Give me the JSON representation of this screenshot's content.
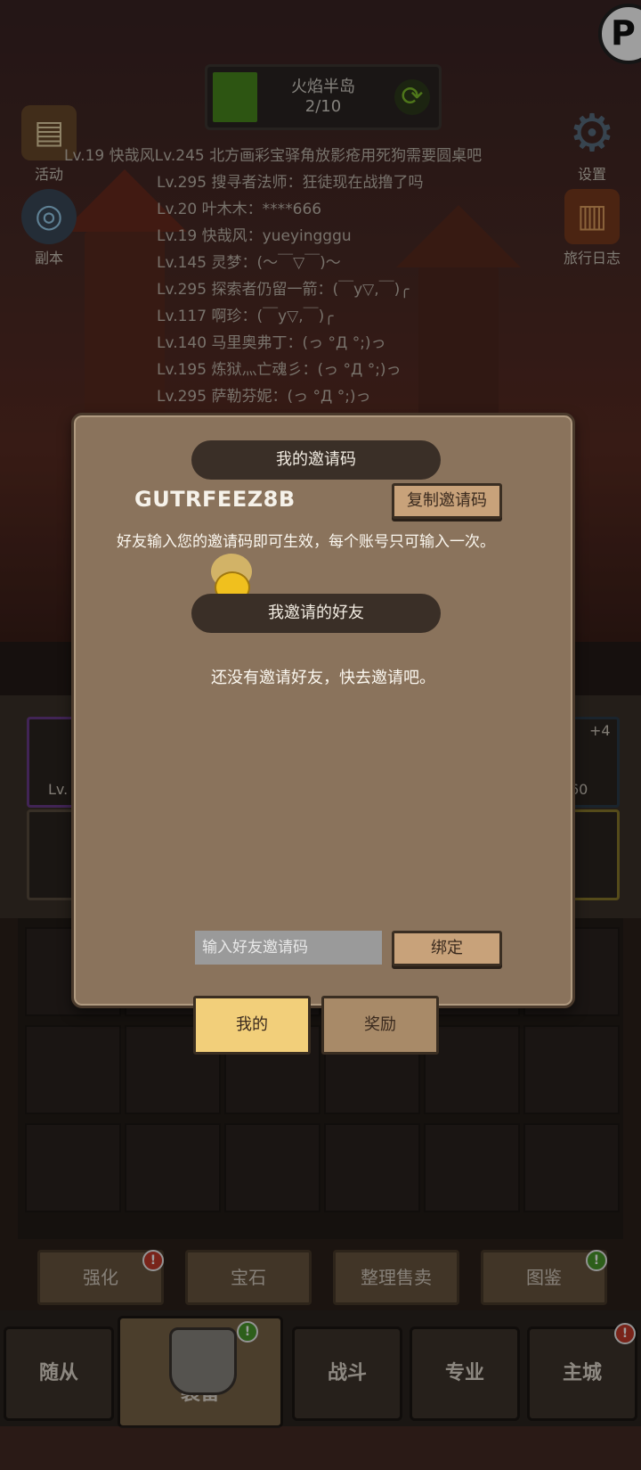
{
  "header": {
    "map_name": "火焰半岛",
    "map_progress": "2/10",
    "left_buttons": [
      "活动",
      "副本"
    ],
    "right_buttons": [
      "设置",
      "旅行日志"
    ]
  },
  "chat": [
    "Lv.19 快哉风Lv.245 北方画彩宝驿角放影疮用死狗需要圆桌吧",
    "Lv.295 搜寻者法师：狂徒现在战撸了吗",
    "Lv.20 叶木木：****666",
    "Lv.19 快哉风：yueyingggu",
    "Lv.145 灵梦：(～￣▽￣)～",
    "Lv.295 探索者仍留一箭：(￣y▽,￣)╭",
    "Lv.117 啊珍：(￣y▽,￣)╭",
    "Lv.140 马里奥弗丁：(っ °Д °;)っ",
    "Lv.195 炼狱灬亡魂彡：(っ °Д °;)っ",
    "Lv.295 萨勒芬妮：(っ °Д °;)っ"
  ],
  "equipment": {
    "slot_left_label": "Lv.",
    "slot_right_plus": "+4",
    "slot_right_value": "60"
  },
  "actions": [
    {
      "label": "强化",
      "badge": "!"
    },
    {
      "label": "宝石",
      "badge": ""
    },
    {
      "label": "整理售卖",
      "badge": ""
    },
    {
      "label": "图鉴",
      "badge": "!"
    }
  ],
  "nav": [
    "随从",
    "装备",
    "战斗",
    "专业",
    "主城"
  ],
  "modal": {
    "my_code_title": "我的邀请码",
    "invite_code": "GUTRFEEZ8B",
    "copy_button": "复制邀请码",
    "note": "好友输入您的邀请码即可生效，每个账号只可输入一次。",
    "friends_title": "我邀请的好友",
    "empty_text": "还没有邀请好友，快去邀请吧。",
    "input_placeholder": "输入好友邀请码",
    "bind_button": "绑定"
  },
  "tabs": {
    "mine": "我的",
    "reward": "奖励"
  },
  "colors": {
    "modal_bg": "#8a735c",
    "ribbon": "#3a2f27",
    "tab_active": "#f2cf7a",
    "badge_red": "#c43a2a",
    "badge_green": "#4a9a2a"
  }
}
